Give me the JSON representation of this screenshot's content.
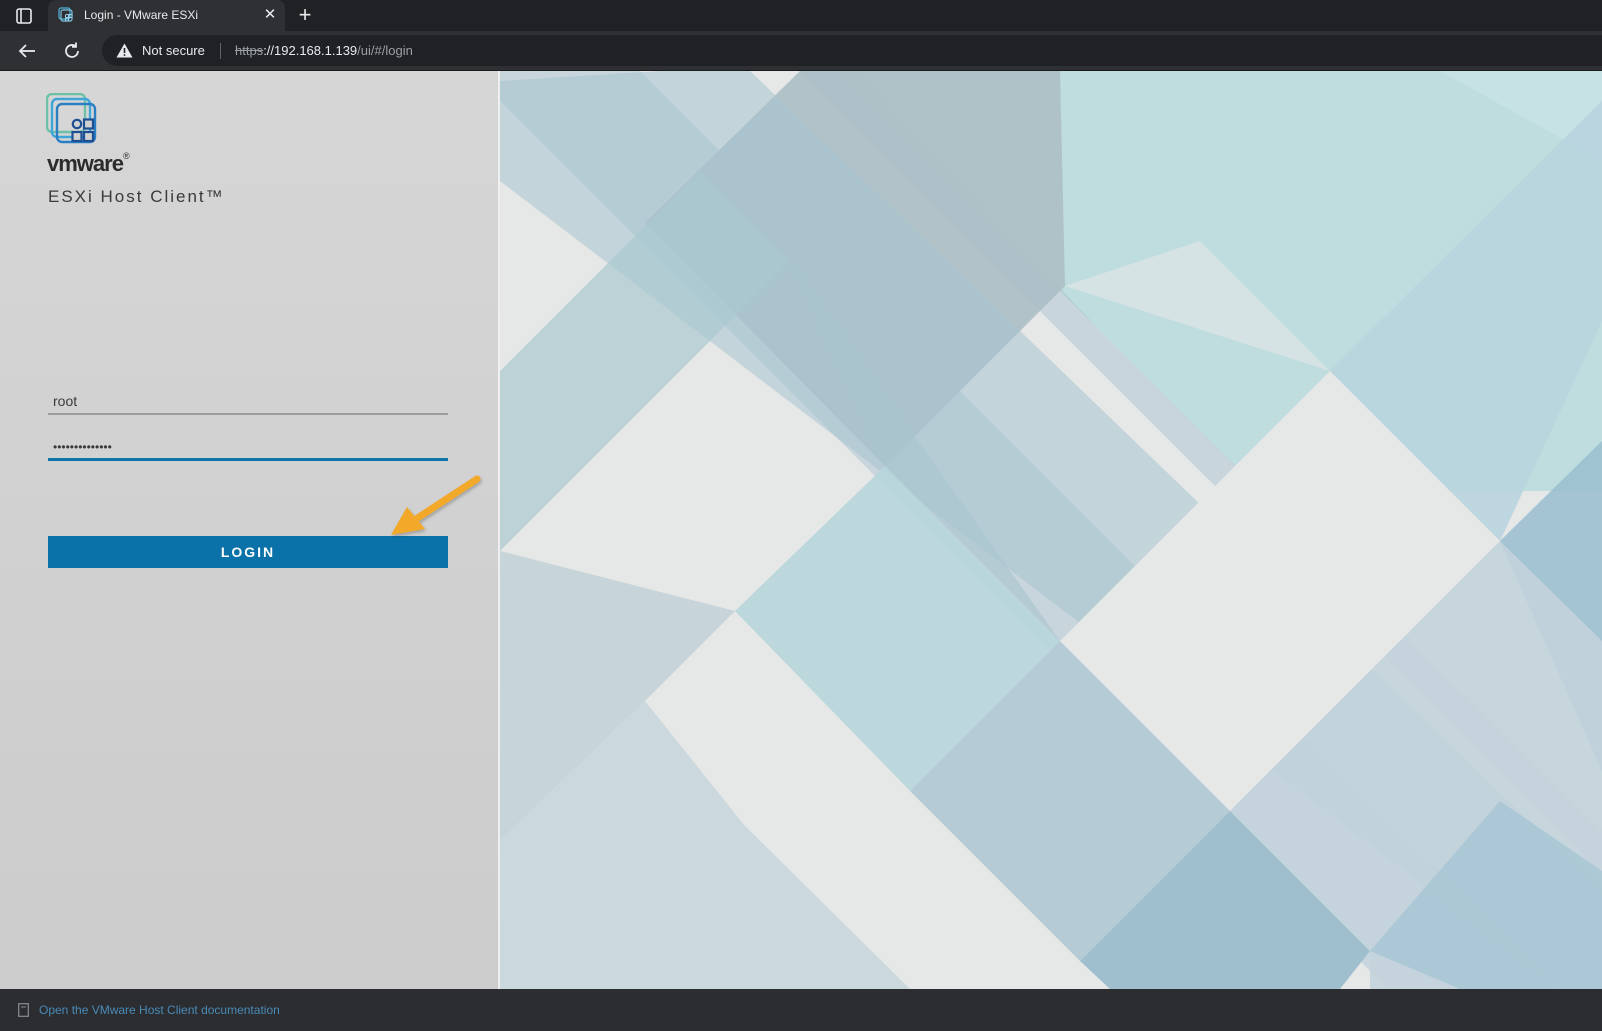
{
  "browser": {
    "tab_title": "Login - VMware ESXi",
    "security_label": "Not secure",
    "url_scheme": "https",
    "url_host": "://192.168.1.139",
    "url_path": "/ui/#/login"
  },
  "login": {
    "brand": "vmware",
    "product": "ESXi Host Client™",
    "username_value": "root",
    "password_value": "••••••••••••••",
    "login_button": "LOGIN"
  },
  "footer": {
    "doc_link": "Open the VMware Host Client documentation"
  },
  "colors": {
    "accent": "#0a72a8",
    "arrow": "#f2a92a"
  }
}
